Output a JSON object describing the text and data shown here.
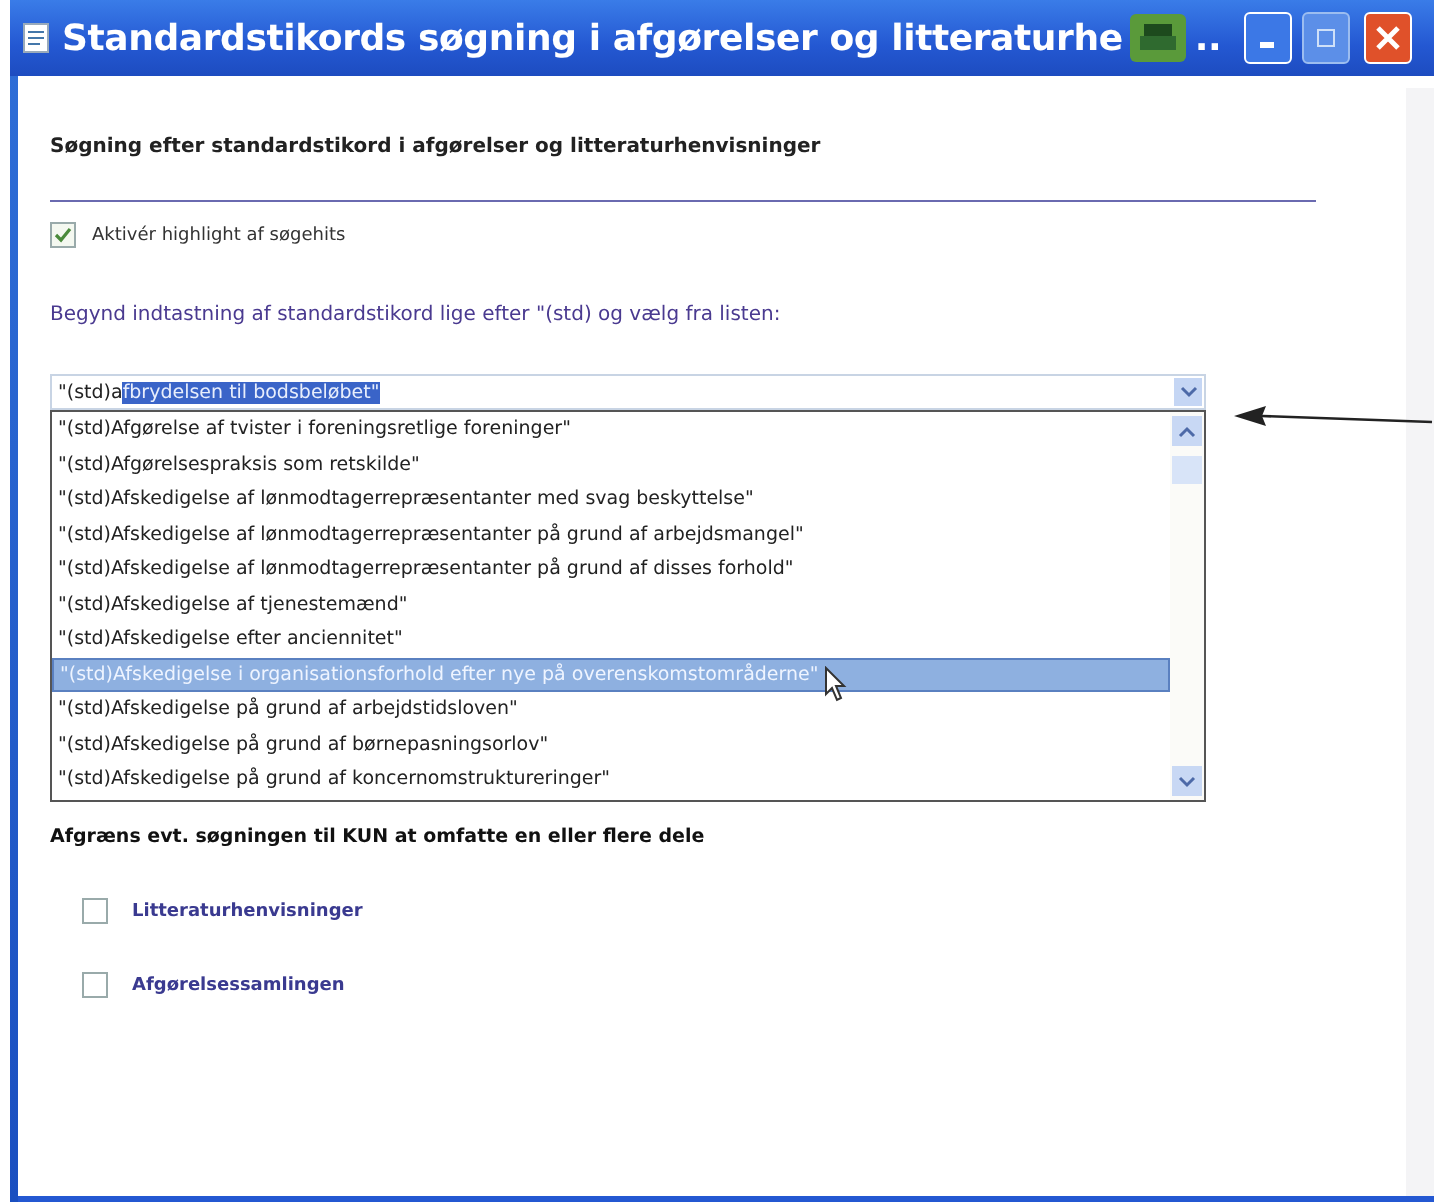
{
  "window": {
    "title": "Standardstikords søgning i afgørelser og litteraturhe",
    "title_ellipsis": ".."
  },
  "heading": "Søgning efter standardstikord i afgørelser og litteraturhenvisninger",
  "highlight_option": {
    "label": "Aktivér highlight af søgehits",
    "checked": true
  },
  "instruction": "Begynd indtastning af standardstikord lige efter \"(std) og vælg fra listen:",
  "combobox": {
    "value": "\"(std)a",
    "autocomplete": "fbrydelsen til bodsbeløbet\""
  },
  "suggestions": [
    {
      "text": "\"(std)Afgørelse af tvister i foreningsretlige foreninger\"",
      "selected": false
    },
    {
      "text": "\"(std)Afgørelsespraksis som retskilde\"",
      "selected": false
    },
    {
      "text": "\"(std)Afskedigelse af lønmodtagerrepræsentanter med svag beskyttelse\"",
      "selected": false
    },
    {
      "text": "\"(std)Afskedigelse af lønmodtagerrepræsentanter på grund af arbejdsmangel\"",
      "selected": false
    },
    {
      "text": "\"(std)Afskedigelse af lønmodtagerrepræsentanter på grund af disses forhold\"",
      "selected": false
    },
    {
      "text": "\"(std)Afskedigelse af tjenestemænd\"",
      "selected": false
    },
    {
      "text": "\"(std)Afskedigelse efter anciennitet\"",
      "selected": false
    },
    {
      "text": "\"(std)Afskedigelse i organisationsforhold efter nye på overenskomstområderne\"",
      "selected": true
    },
    {
      "text": "\"(std)Afskedigelse på grund af arbejdstidsloven\"",
      "selected": false
    },
    {
      "text": "\"(std)Afskedigelse på grund af børnepasningsorlov\"",
      "selected": false
    },
    {
      "text": "\"(std)Afskedigelse på grund af koncernomstruktureringer\"",
      "selected": false
    }
  ],
  "restrict_label": "Afgræns evt. søgningen til KUN at  omfatte en eller flere dele",
  "parts": [
    {
      "label": "Litteraturhenvisninger",
      "checked": false
    },
    {
      "label": "Afgørelsessamlingen",
      "checked": false
    }
  ]
}
